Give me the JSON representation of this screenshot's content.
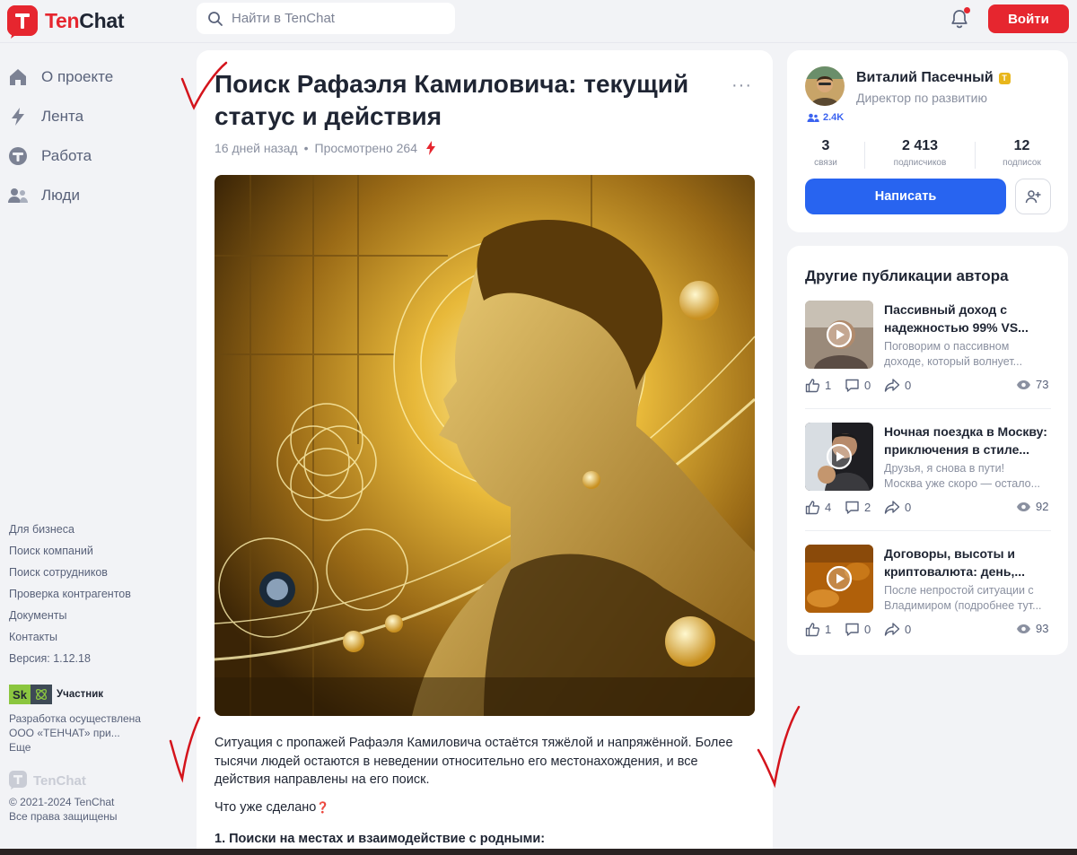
{
  "header": {
    "logo_brand": "Ten",
    "logo_brand2": "Chat",
    "search_placeholder": "Найти в TenChat",
    "login_label": "Войти"
  },
  "nav": [
    {
      "label": "О проекте",
      "icon": "home-icon"
    },
    {
      "label": "Лента",
      "icon": "lightning-icon"
    },
    {
      "label": "Работа",
      "icon": "work-icon"
    },
    {
      "label": "Люди",
      "icon": "people-icon"
    }
  ],
  "footer": {
    "links": [
      "Для бизнеса",
      "Поиск компаний",
      "Поиск сотрудников",
      "Проверка контрагентов",
      "Документы",
      "Контакты",
      "Версия: 1.12.18"
    ],
    "sk_badge": "Sk",
    "sk_label": "Участник",
    "dev_line1": "Разработка осуществлена",
    "dev_line2": "ООО «ТЕНЧАТ» при...",
    "dev_more": "Еще",
    "logo_text": "TenChat",
    "copyright1": "© 2021-2024 TenChat",
    "copyright2": "Все права защищены"
  },
  "post": {
    "title": "Поиск Рафаэля Камиловича: текущий статус и действия",
    "more": "···",
    "age": "16 дней назад",
    "views": "Просмотрено 264",
    "body": "Ситуация с пропажей Рафаэля Камиловича остаётся тяжёлой и напряжённой. Более тысячи людей остаются в неведении относительно его местонахождения, и все действия направлены на его поиск.",
    "question": "Что уже сделано",
    "question_mark": "❓",
    "heading1": "1. Поиски на местах и взаимодействие с родными:"
  },
  "author": {
    "name": "Виталий Пасечный",
    "badge": "T",
    "role": "Директор по развитию",
    "reputation": "2.4K",
    "stats": [
      {
        "value": "3",
        "label": "связи"
      },
      {
        "value": "2 413",
        "label": "подписчиков"
      },
      {
        "value": "12",
        "label": "подписок"
      }
    ],
    "write_label": "Написать"
  },
  "publications": {
    "title": "Другие публикации автора",
    "items": [
      {
        "title1": "Пассивный доход с",
        "title2": "надежностью 99% VS...",
        "desc1": "Поговорим о пассивном",
        "desc2": "доходе, который волнует...",
        "likes": "1",
        "comments": "0",
        "shares": "0",
        "views": "73"
      },
      {
        "title1": "Ночная поездка в Москву:",
        "title2": "приключения в стиле...",
        "desc1": "Друзья, я снова в пути!",
        "desc2": "Москва уже скоро — остало...",
        "likes": "4",
        "comments": "2",
        "shares": "0",
        "views": "92"
      },
      {
        "title1": "Договоры, высоты и",
        "title2": "криптовалюта: день,...",
        "desc1": "После непростой ситуации с",
        "desc2": "Владимиром (подробнее тут...",
        "likes": "1",
        "comments": "0",
        "shares": "0",
        "views": "93"
      }
    ]
  },
  "colors": {
    "brand_red": "#e6262f",
    "accent_blue": "#2864f0",
    "annotation_red": "#d4141c"
  }
}
